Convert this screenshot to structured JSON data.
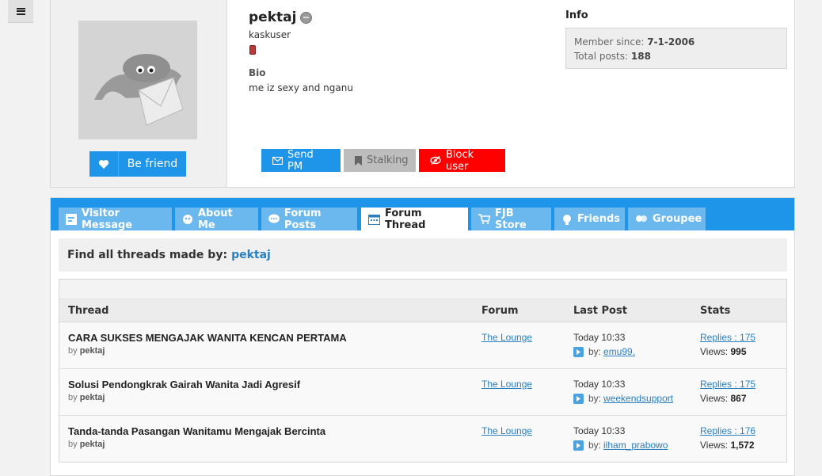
{
  "profile": {
    "username": "pektaj",
    "rank": "kaskuser",
    "bio_label": "Bio",
    "bio": "me iz sexy and nganu",
    "befriend_label": "Be friend"
  },
  "info": {
    "label": "Info",
    "member_since_label": "Member since:",
    "member_since": "7-1-2006",
    "total_posts_label": "Total posts:",
    "total_posts": "188"
  },
  "actions": {
    "send_pm": "Send PM",
    "stalking": "Stalking",
    "block_user": "Block user"
  },
  "tabs": [
    {
      "label": "Visitor Message",
      "active": false
    },
    {
      "label": "About Me",
      "active": false
    },
    {
      "label": "Forum Posts",
      "active": false
    },
    {
      "label": "Forum Thread",
      "active": true
    },
    {
      "label": "FJB Store",
      "active": false
    },
    {
      "label": "Friends",
      "active": false
    },
    {
      "label": "Groupee",
      "active": false
    }
  ],
  "find": {
    "label": "Find all threads made by:",
    "user": "pektaj"
  },
  "table": {
    "headers": {
      "thread": "Thread",
      "forum": "Forum",
      "last_post": "Last Post",
      "stats": "Stats"
    },
    "rows": [
      {
        "title": "CARA SUKSES MENGAJAK WANITA KENCAN PERTAMA",
        "by_prefix": "by",
        "author": "pektaj",
        "forum": "The Lounge",
        "time": "Today 10:33",
        "last_by_prefix": "by:",
        "last_by": "emu99.",
        "replies": "Replies : 175",
        "views_label": "Views:",
        "views": "995"
      },
      {
        "title": "Solusi Pendongkrak Gairah Wanita Jadi Agresif",
        "by_prefix": "by",
        "author": "pektaj",
        "forum": "The Lounge",
        "time": "Today 10:33",
        "last_by_prefix": "by:",
        "last_by": "weekendsupport",
        "replies": "Replies : 175",
        "views_label": "Views:",
        "views": "867"
      },
      {
        "title": "Tanda-tanda Pasangan Wanitamu Mengajak Bercinta",
        "by_prefix": "by",
        "author": "pektaj",
        "forum": "The Lounge",
        "time": "Today 10:33",
        "last_by_prefix": "by:",
        "last_by": "ilham_prabowo",
        "replies": "Replies : 176",
        "views_label": "Views:",
        "views": "1,572"
      }
    ]
  },
  "colors": {
    "accent": "#1e95e8",
    "tab_inactive": "#6bb8ee",
    "block": "#ff0000",
    "link": "#2a7fbf"
  },
  "icons": {
    "menu": "hamburger-icon",
    "befriend": "heart-icon",
    "send_pm": "envelope-icon",
    "stalking": "bookmark-icon",
    "block": "eye-slash-icon",
    "last_post": "arrow-right-icon"
  }
}
